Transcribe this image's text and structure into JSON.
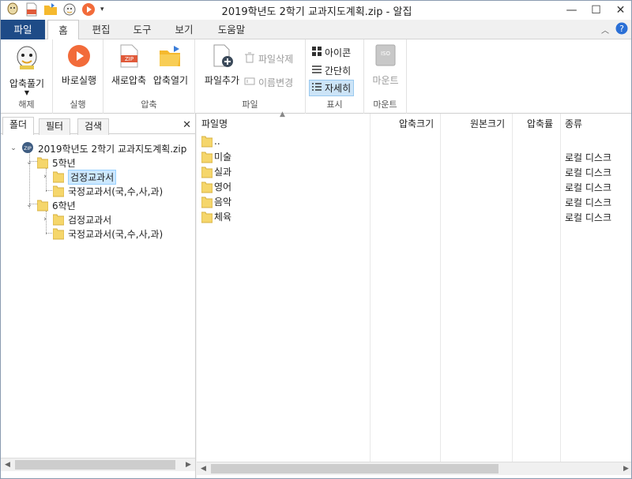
{
  "window": {
    "title": "2019학년도 2학기 교과지도계획.zip - 알집",
    "minimize": "—",
    "maximize": "☐",
    "close": "✕"
  },
  "quick_access": [
    "app-logo-icon",
    "new-zip-icon",
    "open-folder-icon",
    "mascot-icon",
    "run-icon"
  ],
  "ribbon_tabs": [
    {
      "label": "파일",
      "kind": "file"
    },
    {
      "label": "홈",
      "kind": "active"
    },
    {
      "label": "편집",
      "kind": "normal"
    },
    {
      "label": "도구",
      "kind": "normal"
    },
    {
      "label": "보기",
      "kind": "normal"
    },
    {
      "label": "도움말",
      "kind": "normal"
    }
  ],
  "ribbon": {
    "extract": {
      "label": "압축풀기",
      "group": "해제"
    },
    "run": {
      "label": "바로실행",
      "group": "실행"
    },
    "new_zip": {
      "label": "새로압축"
    },
    "open_zip": {
      "label": "압축열기"
    },
    "compress_group": "압축",
    "add_file": {
      "label": "파일추가"
    },
    "delete_file": {
      "label": "파일삭제"
    },
    "rename": {
      "label": "이름변경"
    },
    "file_group": "파일",
    "view_icon": "아이콘",
    "view_simple": "간단히",
    "view_detail": "자세히",
    "view_group": "표시",
    "mount": {
      "label": "마운트",
      "icon_text": "ISO"
    },
    "mount_group": "마운트"
  },
  "left_tabs": [
    "폴더",
    "필터",
    "검색"
  ],
  "left_close": "✕",
  "tree": {
    "root": "2019학년도 2학기 교과지도계획.zip",
    "root_badge": "ZIP",
    "grade5": "5학년",
    "grade5_children": [
      "검정교과서",
      "국정교과서(국,수,사,과)"
    ],
    "grade6": "6학년",
    "grade6_children": [
      "검정교과서",
      "국정교과서(국,수,사,과)"
    ]
  },
  "columns": {
    "name": "파일명",
    "compressed": "압축크기",
    "original": "원본크기",
    "ratio": "압축률",
    "kind": "종류"
  },
  "files": [
    {
      "name": "..",
      "kind": ""
    },
    {
      "name": "미술",
      "kind": "로컬 디스크"
    },
    {
      "name": "실과",
      "kind": "로컬 디스크"
    },
    {
      "name": "영어",
      "kind": "로컬 디스크"
    },
    {
      "name": "음악",
      "kind": "로컬 디스크"
    },
    {
      "name": "체육",
      "kind": "로컬 디스크"
    }
  ],
  "colors": {
    "file_tab": "#1e4b87",
    "selection": "#cce8ff",
    "folder": "#f5d66b",
    "run_button": "#f26b3a"
  }
}
